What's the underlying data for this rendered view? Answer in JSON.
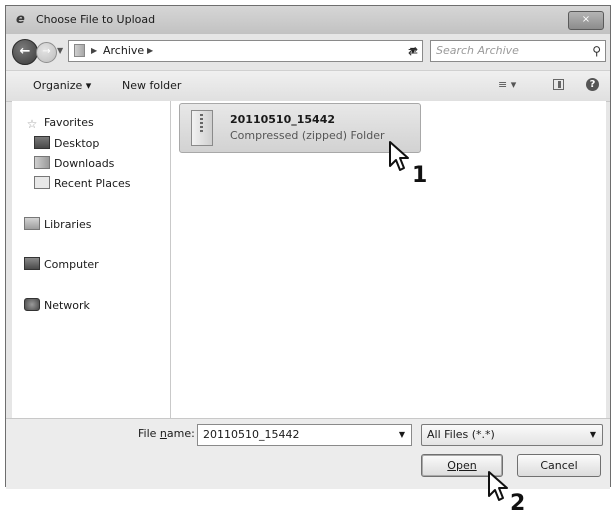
{
  "window": {
    "title": "Choose File to Upload",
    "close_label": "×"
  },
  "nav": {
    "back_glyph": "←",
    "forward_glyph": "→"
  },
  "address": {
    "crumb": "Archive",
    "sep": "▶",
    "dropdown": "▼"
  },
  "search": {
    "placeholder": "Search Archive"
  },
  "toolbar": {
    "organize": "Organize ▾",
    "new_folder": "New folder",
    "views_glyph": "≡ ▾",
    "help": "?"
  },
  "sidebar": {
    "favorites": "Favorites",
    "desktop": "Desktop",
    "downloads": "Downloads",
    "recent": "Recent Places",
    "libraries": "Libraries",
    "computer": "Computer",
    "network": "Network"
  },
  "file": {
    "name": "20110510_15442",
    "type": "Compressed (zipped) Folder"
  },
  "footer": {
    "filename_label_pre": "File ",
    "filename_label_u": "n",
    "filename_label_post": "ame:",
    "filename_value": "20110510_15442",
    "filter_value": "All Files (*.*)",
    "open_label": "Open",
    "cancel_label": "Cancel"
  },
  "callouts": {
    "step1": "1",
    "step2": "2"
  },
  "colors": {
    "chrome": "#e6e6e6",
    "selection": "#d8d8d8",
    "pane": "#ffffff"
  }
}
